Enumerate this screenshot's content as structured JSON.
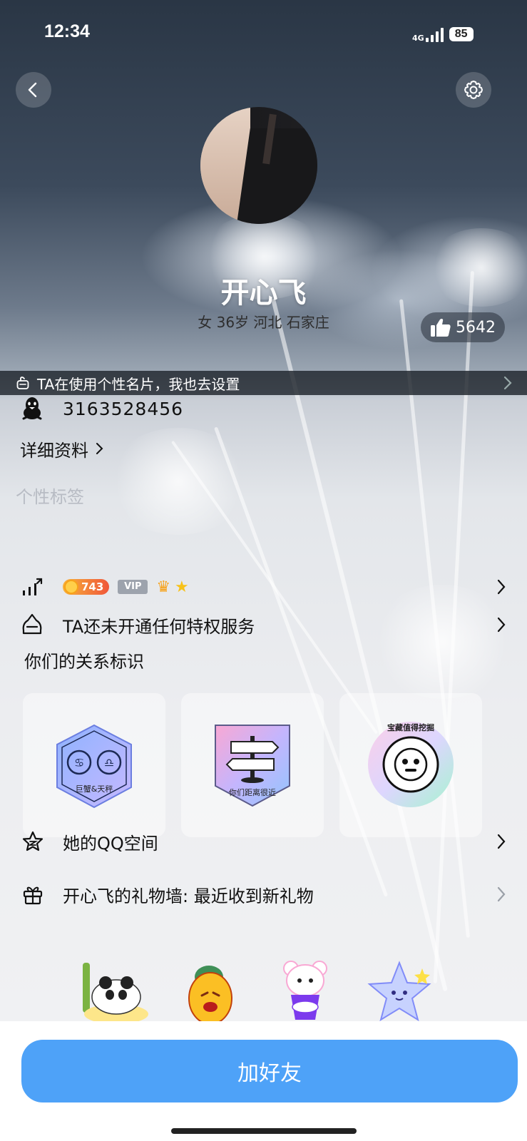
{
  "status_bar": {
    "time": "12:34",
    "network": "4G",
    "battery": "85"
  },
  "profile": {
    "nickname": "开心飞",
    "subinfo": "女 36岁 河北 石家庄",
    "likes": "5642",
    "qq_number": "3163528456"
  },
  "banner": {
    "text": "TA在使用个性名片，我也去设置"
  },
  "links": {
    "detail": "详细资料",
    "tags_placeholder": "个性标签"
  },
  "level": {
    "coin_value": "743",
    "vip_label": "VIP"
  },
  "privilege": {
    "text": "TA还未开通任何特权服务"
  },
  "relation": {
    "title": "你们的关系标识",
    "badges": [
      {
        "label": "巨蟹&天秤"
      },
      {
        "label": "你们距离很近"
      },
      {
        "label": "宝藏值得挖掘"
      }
    ]
  },
  "qzone": {
    "text": "她的QQ空间"
  },
  "gift_wall": {
    "text": "开心飞的礼物墙: 最近收到新礼物"
  },
  "actions": {
    "add_friend": "加好友"
  },
  "colors": {
    "accent": "#4ea2f8"
  }
}
